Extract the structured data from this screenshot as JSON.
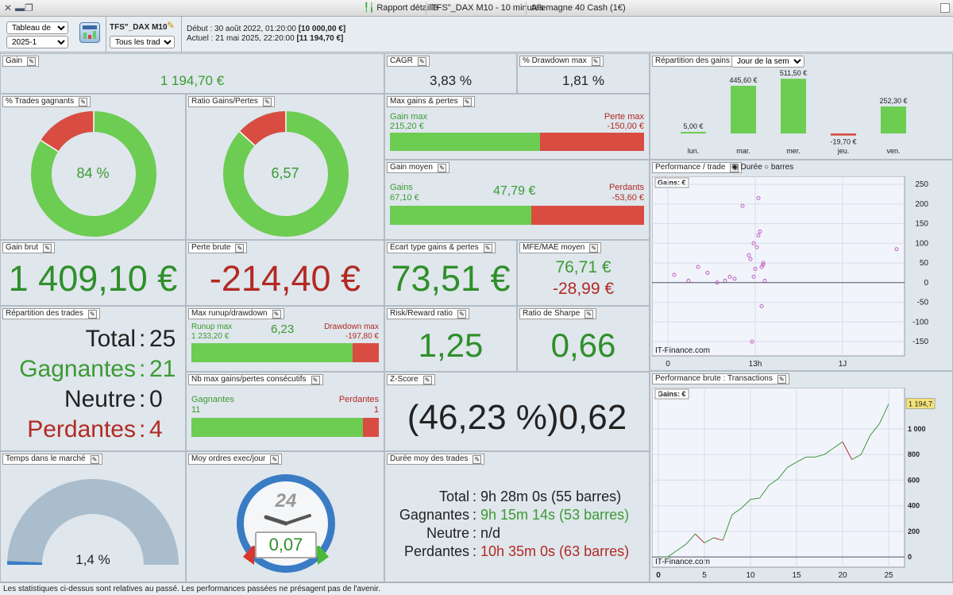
{
  "titlebar": {
    "segments": [
      "Rapport détaillé",
      "TFS\"_DAX M10 - 10 minutes",
      "Allemagne 40 Cash (1€)"
    ]
  },
  "header": {
    "view_select": "Tableau de bord",
    "period_select": "2025-1",
    "strategy_name": "TFS\"_DAX M10",
    "trades_filter": "Tous les trades",
    "start_label": "Début :",
    "start_value": "30 août 2022, 01:20:00",
    "start_capital": "[10 000,00 €]",
    "current_label": "Actuel :",
    "current_value": "21 mai 2025, 22:20:00",
    "current_capital": "[11 194,70 €]"
  },
  "gain": {
    "label": "Gain",
    "value": "1 194,70 €"
  },
  "cagr": {
    "label": "CAGR",
    "value": "3,83 %"
  },
  "drawdown_max": {
    "label": "% Drawdown max",
    "value": "1,81 %"
  },
  "pct_winning": {
    "label": "% Trades gagnants",
    "value": "84 %",
    "fraction": 0.84
  },
  "ratio_gp": {
    "label": "Ratio Gains/Pertes",
    "value": "6,57",
    "fraction": 0.868
  },
  "max_gains_losses": {
    "label": "Max gains & pertes",
    "gain_label": "Gain max",
    "gain_value": "215,20 €",
    "loss_label": "Perte max",
    "loss_value": "-150,00 €",
    "gain_fraction": 0.59
  },
  "avg_gain": {
    "label": "Gain moyen",
    "gain_label": "Gains",
    "gain_value": "67,10 €",
    "center_value": "47,79 €",
    "loss_label": "Perdants",
    "loss_value": "-53,60 €",
    "gain_fraction": 0.556
  },
  "gross_gain": {
    "label": "Gain brut",
    "value": "1 409,10 €"
  },
  "gross_loss": {
    "label": "Perte brute",
    "value": "-214,40 €"
  },
  "std_dev": {
    "label": "Ecart type gains & pertes",
    "value": "73,51 €"
  },
  "mfe_mae": {
    "label": "MFE/MAE moyen",
    "mfe": "76,71 €",
    "mae": "-28,99 €"
  },
  "trade_dist": {
    "label": "Répartition des trades",
    "rows": [
      {
        "name": "Total",
        "sep": ":",
        "value": "25"
      },
      {
        "name": "Gagnantes",
        "sep": ":",
        "value": "21"
      },
      {
        "name": "Neutre",
        "sep": ":",
        "value": "0"
      },
      {
        "name": "Perdantes",
        "sep": ":",
        "value": "4"
      }
    ]
  },
  "runup": {
    "label": "Max runup/drawdown",
    "runup_label": "Runup max",
    "runup_value": "1 233,20 €",
    "center_value": "6,23",
    "dd_label": "Drawdown max",
    "dd_value": "-197,80 €",
    "runup_fraction": 0.86
  },
  "risk_reward": {
    "label": "Risk/Reward ratio",
    "value": "1,25"
  },
  "sharpe": {
    "label": "Ratio de Sharpe",
    "value": "0,66"
  },
  "consecutive": {
    "label": "Nb max gains/pertes consécutifs",
    "win_label": "Gagnantes",
    "win_value": "11",
    "loss_label": "Perdantes",
    "loss_value": "1",
    "win_fraction": 0.917
  },
  "zscore": {
    "label": "Z-Score",
    "value": "(46,23 %)0,62"
  },
  "time_in_market": {
    "label": "Temps dans le marché",
    "value": "1,4 %",
    "fraction": 0.014
  },
  "avg_orders": {
    "label": "Moy ordres exec/jour",
    "clock_number": "24",
    "value": "0,07"
  },
  "avg_duration": {
    "label": "Durée moy des trades",
    "rows": [
      {
        "name": "Total",
        "sep": ":",
        "value": "9h 28m 0s (55 barres)"
      },
      {
        "name": "Gagnantes",
        "sep": ":",
        "value": "9h 15m 14s (53 barres)"
      },
      {
        "name": "Neutre",
        "sep": ":",
        "value": "n/d"
      },
      {
        "name": "Perdantes",
        "sep": ":",
        "value": "10h 35m 0s (63 barres)"
      }
    ]
  },
  "gain_distribution": {
    "label": "Répartition des gains",
    "period_select": "Jour de la semaine"
  },
  "perf_trade": {
    "label": "Performance / trade",
    "radio_duration": "Durée",
    "radio_bars": "barres",
    "axis_title": "Gains: €",
    "watermark": "IT-Finance.com"
  },
  "perf_gross": {
    "label": "Performance brute : Transactions",
    "axis_title": "Gains: €",
    "watermark": "IT-Finance.com",
    "last_value": "1 194,7"
  },
  "footer": {
    "text": "Les statistiques ci-dessus sont relatives au passé. Les performances passées ne présagent pas de l'avenir."
  },
  "colors": {
    "green": "#6dcc52",
    "red": "#d94c42",
    "text_green": "#3c9a33",
    "text_red": "#b22a22"
  },
  "chart_data": [
    {
      "type": "bar",
      "title": "Répartition des gains",
      "categories": [
        "lun.",
        "mar.",
        "mer.",
        "jeu.",
        "ven."
      ],
      "values": [
        5.0,
        445.6,
        511.5,
        -19.7,
        252.3
      ],
      "value_labels": [
        "5,00 €",
        "445,60 €",
        "511,50 €",
        "-19,70 €",
        "252,30 €"
      ]
    },
    {
      "type": "scatter",
      "title": "Performance / trade",
      "ylabel": "Gains: €",
      "ylim": [
        -170,
        250
      ],
      "yticks": [
        250,
        200,
        150,
        100,
        50,
        0,
        -50,
        -100,
        -150
      ],
      "xtick_labels": [
        "0",
        "13h",
        "1J"
      ],
      "points": [
        [
          0.4,
          20
        ],
        [
          1.3,
          5
        ],
        [
          1.9,
          40
        ],
        [
          2.5,
          25
        ],
        [
          3.1,
          0
        ],
        [
          3.6,
          5
        ],
        [
          3.9,
          15
        ],
        [
          4.2,
          10
        ],
        [
          4.7,
          195
        ],
        [
          5.2,
          60
        ],
        [
          5.4,
          100
        ],
        [
          5.6,
          90
        ],
        [
          5.7,
          215
        ],
        [
          5.8,
          130
        ],
        [
          5.9,
          -60
        ],
        [
          6.0,
          50
        ],
        [
          6.1,
          5
        ],
        [
          5.5,
          35
        ],
        [
          5.9,
          40
        ],
        [
          5.3,
          -150
        ],
        [
          5.4,
          15
        ],
        [
          14.4,
          85
        ],
        [
          5.7,
          120
        ],
        [
          5.1,
          70
        ],
        [
          6.0,
          45
        ]
      ]
    },
    {
      "type": "line",
      "title": "Performance brute : Transactions",
      "ylabel": "Gains: €",
      "ylim": [
        -30,
        1260
      ],
      "yticks": [
        1000,
        800,
        600,
        400,
        200,
        0
      ],
      "xticks": [
        0,
        5,
        10,
        15,
        20,
        25
      ],
      "x": [
        0,
        1,
        2,
        3,
        4,
        5,
        6,
        7,
        8,
        9,
        10,
        11,
        12,
        13,
        14,
        15,
        16,
        17,
        18,
        19,
        20,
        21,
        22,
        23,
        24,
        25
      ],
      "y": [
        0,
        0,
        50,
        100,
        180,
        110,
        150,
        130,
        330,
        380,
        450,
        460,
        560,
        610,
        700,
        740,
        780,
        780,
        800,
        850,
        900,
        760,
        800,
        950,
        1040,
        1194.7
      ],
      "negative_segments": [
        [
          4,
          5
        ],
        [
          6,
          7
        ],
        [
          20,
          21
        ]
      ]
    }
  ]
}
